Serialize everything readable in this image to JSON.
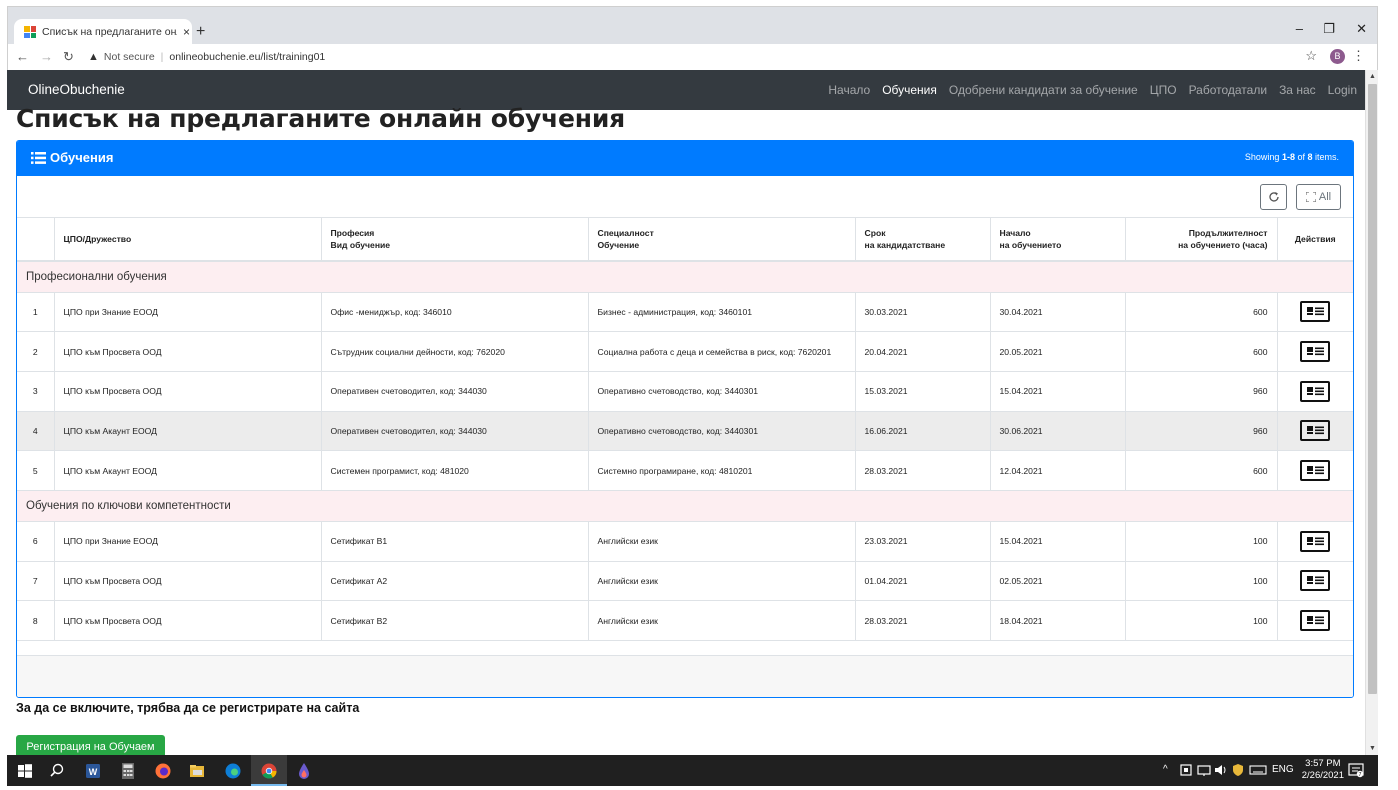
{
  "browser": {
    "tab_title": "Списък на предлаганите онлайн",
    "tab_close": "×",
    "new_tab": "+",
    "not_secure": "Not secure",
    "url": "onlineobuchenie.eu/list/training01",
    "profile_initial": "B",
    "window_controls": [
      "–",
      "❐",
      "✕"
    ]
  },
  "site": {
    "brand": "OlineObuchenie",
    "nav": [
      {
        "label": "Начало",
        "active": false
      },
      {
        "label": "Обучения",
        "active": true
      },
      {
        "label": "Одобрени кандидати за обучение",
        "active": false
      },
      {
        "label": "ЦПО",
        "active": false
      },
      {
        "label": "Работодатали",
        "active": false
      },
      {
        "label": "За нас",
        "active": false
      },
      {
        "label": "Login",
        "active": false
      }
    ]
  },
  "page": {
    "title": "Списък на предлаганите онлайн обучения",
    "card_title": "Обучения",
    "summary_prefix": "Showing ",
    "summary_range": "1-8",
    "summary_mid": " of ",
    "summary_total": "8",
    "summary_suffix": " items.",
    "toggle_all_label": "All",
    "columns": {
      "company": "ЦПО/Дружество",
      "profession_1": "Професия",
      "profession_2": "Вид обучение",
      "specialty_1": "Специалност",
      "specialty_2": "Обучение",
      "deadline_1": "Срок",
      "deadline_2": "на кандидатстване",
      "start_1": "Начало",
      "start_2": "на обучението",
      "duration_1": "Продължителност",
      "duration_2": "на обучението (часа)",
      "actions": "Действия"
    },
    "groups": [
      {
        "name": "Професионални обучения",
        "rows": [
          {
            "n": "1",
            "company": "ЦПО при Знание ЕООД",
            "profession": "Офис -мениджър, код: 346010",
            "specialty": "Бизнес - администрация, код: 3460101",
            "deadline": "30.03.2021",
            "start": "30.04.2021",
            "hours": "600"
          },
          {
            "n": "2",
            "company": "ЦПО към Просвета ООД",
            "profession": "Сътрудник социални дейности, код: 762020",
            "specialty": "Социална работа с деца и семейства в риск, код: 7620201",
            "deadline": "20.04.2021",
            "start": "20.05.2021",
            "hours": "600"
          },
          {
            "n": "3",
            "company": "ЦПО към Просвета ООД",
            "profession": "Оперативен счетоводител, код: 344030",
            "specialty": "Оперативно счетоводство, код: 3440301",
            "deadline": "15.03.2021",
            "start": "15.04.2021",
            "hours": "960"
          },
          {
            "n": "4",
            "company": "ЦПО към Акаунт ЕООД",
            "profession": "Оперативен счетоводител, код: 344030",
            "specialty": "Оперативно счетоводство, код: 3440301",
            "deadline": "16.06.2021",
            "start": "30.06.2021",
            "hours": "960"
          },
          {
            "n": "5",
            "company": "ЦПО към Акаунт ЕООД",
            "profession": "Системен програмист, код: 481020",
            "specialty": "Системно програмиране, код: 4810201",
            "deadline": "28.03.2021",
            "start": "12.04.2021",
            "hours": "600"
          }
        ]
      },
      {
        "name": "Обучения по ключови компетентности",
        "rows": [
          {
            "n": "6",
            "company": "ЦПО при Знание ЕООД",
            "profession": "Сетификат B1",
            "specialty": "Английски език",
            "deadline": "23.03.2021",
            "start": "15.04.2021",
            "hours": "100"
          },
          {
            "n": "7",
            "company": "ЦПО към Просвета ООД",
            "profession": "Сетификат А2",
            "specialty": "Английски език",
            "deadline": "01.04.2021",
            "start": "02.05.2021",
            "hours": "100"
          },
          {
            "n": "8",
            "company": "ЦПО към Просвета ООД",
            "profession": "Сетификат B2",
            "specialty": "Английски език",
            "deadline": "28.03.2021",
            "start": "18.04.2021",
            "hours": "100"
          }
        ]
      }
    ],
    "notice": "За да се включите, трябва да се регистрирате на сайта",
    "register_button": "Регистрация на Обучаем"
  },
  "taskbar": {
    "tray_text": "ENG",
    "time": "3:57 PM",
    "date": "2/26/2021"
  },
  "colors": {
    "primary": "#007bff",
    "navbar": "#343a40",
    "success": "#28a745",
    "group_row": "#fdeef1"
  }
}
